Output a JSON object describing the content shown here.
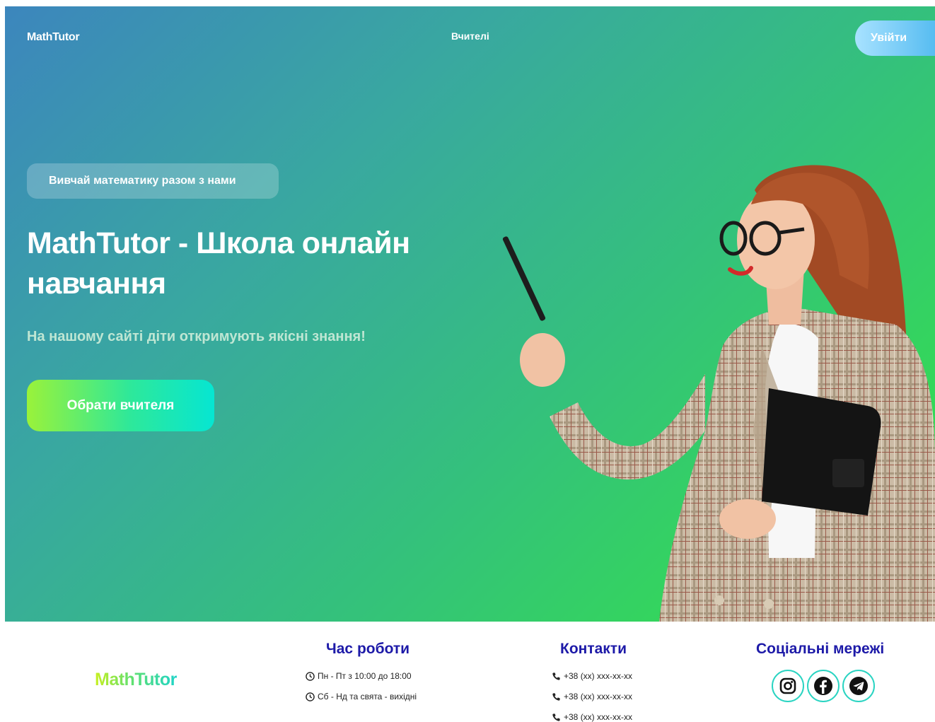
{
  "header": {
    "brand": "MathTutor",
    "nav_teachers": "Вчителі",
    "login_label": "Увійти"
  },
  "hero": {
    "tagline": "Вивчай математику разом з нами",
    "title": "MathTutor - Школа онлайн навчання",
    "subtitle": "На нашому сайті діти откримують якісні знання!",
    "cta_label": "Обрати вчителя"
  },
  "footer": {
    "brand": "MathTutor",
    "hours": {
      "title": "Час роботи",
      "lines": [
        "Пн - Пт з 10:00 до 18:00",
        "Сб - Нд та свята - вихідні"
      ]
    },
    "contacts": {
      "title": "Контакти",
      "phones": [
        "+38 (xx) xxx-xx-xx",
        "+38 (xx) xxx-xx-xx",
        "+38 (xx) xxx-xx-xx"
      ]
    },
    "social": {
      "title": "Соціальні мережі",
      "icons": [
        "instagram-icon",
        "facebook-icon",
        "telegram-icon"
      ]
    }
  },
  "colors": {
    "footer_heading": "#1d1aa8",
    "accent_teal": "#2ad4c2",
    "hero_gradient_start": "#3c86bd",
    "hero_gradient_end": "#33e545"
  }
}
